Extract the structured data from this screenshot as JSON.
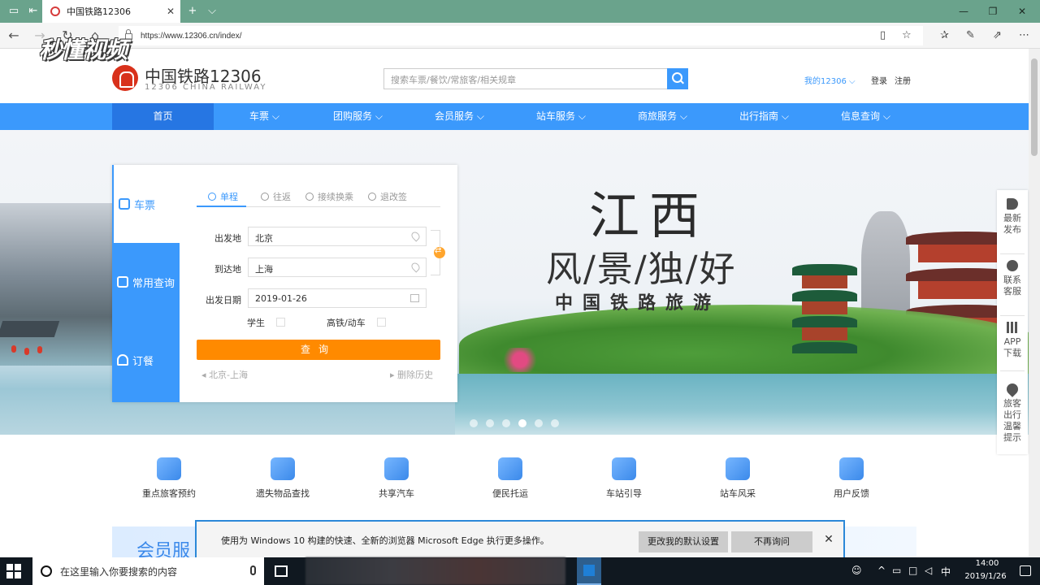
{
  "browser": {
    "tab_title": "中国铁路12306",
    "tab_close": "✕",
    "new_tab": "+",
    "tab_menu": "⌵",
    "url": "https://www.12306.cn/index/",
    "win_min": "—",
    "win_max": "❐",
    "win_close": "✕"
  },
  "watermark": "秒懂视频",
  "header": {
    "logo_name": "中国铁路12306",
    "logo_sub": "12306 CHINA RAILWAY",
    "search_placeholder": "搜索车票/餐饮/常旅客/相关规章",
    "my12306": "我的12306 ⌵",
    "login": "登录",
    "register": "注册"
  },
  "nav": [
    {
      "label": "首页"
    },
    {
      "label": "车票 ⌵"
    },
    {
      "label": "团购服务 ⌵"
    },
    {
      "label": "会员服务 ⌵"
    },
    {
      "label": "站车服务 ⌵"
    },
    {
      "label": "商旅服务 ⌵"
    },
    {
      "label": "出行指南 ⌵"
    },
    {
      "label": "信息查询 ⌵"
    }
  ],
  "hero": {
    "title": "江西",
    "subtitle": "风/景/独/好",
    "subtitle2": "中国铁路旅游"
  },
  "booking": {
    "side_tabs": [
      {
        "label": "车票"
      },
      {
        "label": "常用查询"
      },
      {
        "label": "订餐"
      }
    ],
    "tabs": [
      {
        "label": "单程"
      },
      {
        "label": "往返"
      },
      {
        "label": "接续换乘"
      },
      {
        "label": "退改签"
      }
    ],
    "from_label": "出发地",
    "from_value": "北京",
    "to_label": "到达地",
    "to_value": "上海",
    "date_label": "出发日期",
    "date_value": "2019-01-26",
    "student_label": "学生",
    "gd_label": "高铁/动车",
    "query_btn": "查询",
    "history": "◂ 北京-上海",
    "clear_history": "▸ 删除历史"
  },
  "float_bar": [
    {
      "label": "最新发布"
    },
    {
      "label": "联系客服"
    },
    {
      "label": "APP下载"
    },
    {
      "label": "旅客出行温馨提示"
    }
  ],
  "services": [
    {
      "label": "重点旅客预约"
    },
    {
      "label": "遗失物品查找"
    },
    {
      "label": "共享汽车"
    },
    {
      "label": "便民托运"
    },
    {
      "label": "车站引导"
    },
    {
      "label": "站车风采"
    },
    {
      "label": "用户反馈"
    }
  ],
  "member_text": "会员服",
  "edge_notice": {
    "text": "使用为 Windows 10 构建的快速、全新的浏览器 Microsoft Edge 执行更多操作。",
    "btn_default": "更改我的默认设置",
    "btn_never": "不再询问",
    "close": "✕"
  },
  "taskbar": {
    "search_placeholder": "在这里输入你要搜索的内容",
    "ime": "中",
    "time": "14:00",
    "date": "2019/1/26"
  }
}
